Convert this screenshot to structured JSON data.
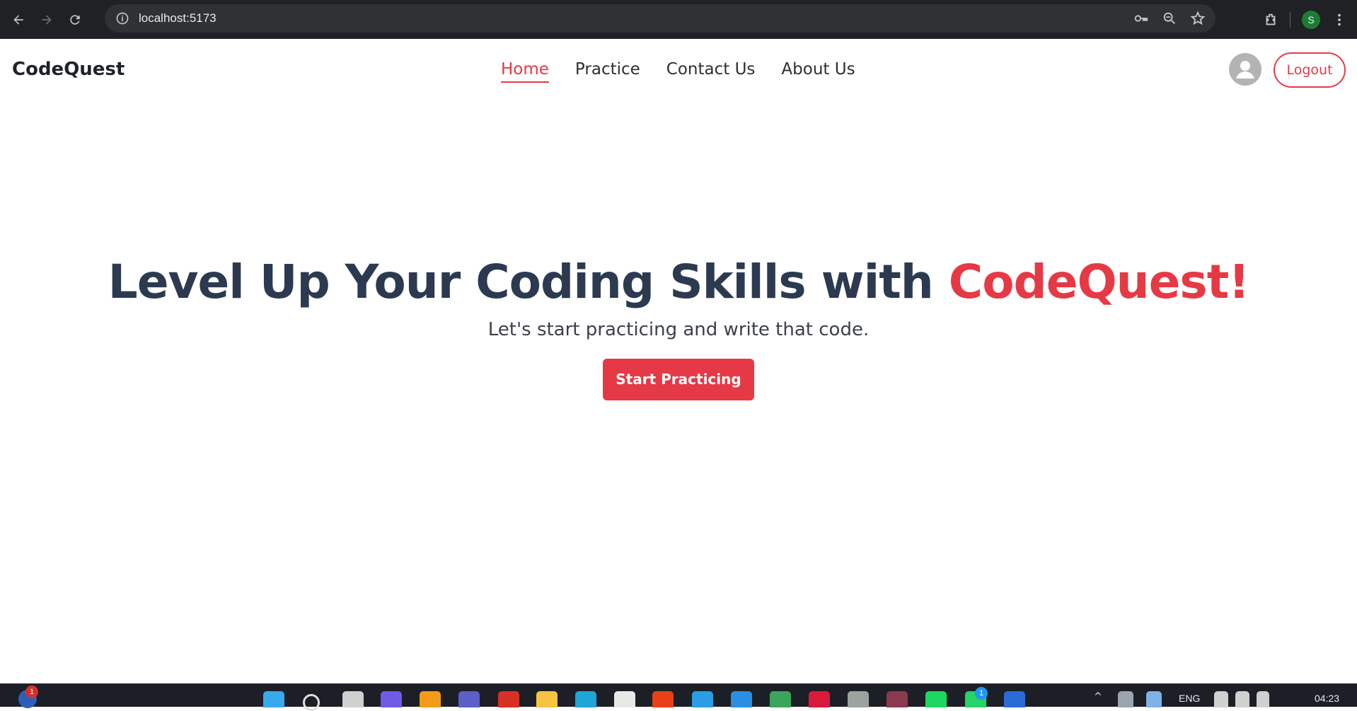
{
  "browser": {
    "url": "localhost:5173",
    "profile_initial": "S"
  },
  "nav": {
    "logo": "CodeQuest",
    "items": [
      {
        "label": "Home",
        "active": true
      },
      {
        "label": "Practice",
        "active": false
      },
      {
        "label": "Contact Us",
        "active": false
      },
      {
        "label": "About Us",
        "active": false
      }
    ],
    "logout_label": "Logout"
  },
  "hero": {
    "title_prefix": "Level Up Your Coding Skills with ",
    "title_accent": "CodeQuest!",
    "subtitle": "Let's start practicing and write that code.",
    "cta_label": "Start Practicing"
  },
  "taskbar": {
    "language": "ENG",
    "time": "04:23",
    "badges": [
      "1",
      "1"
    ]
  },
  "colors": {
    "accent": "#e63946",
    "heading": "#2b3a50"
  }
}
